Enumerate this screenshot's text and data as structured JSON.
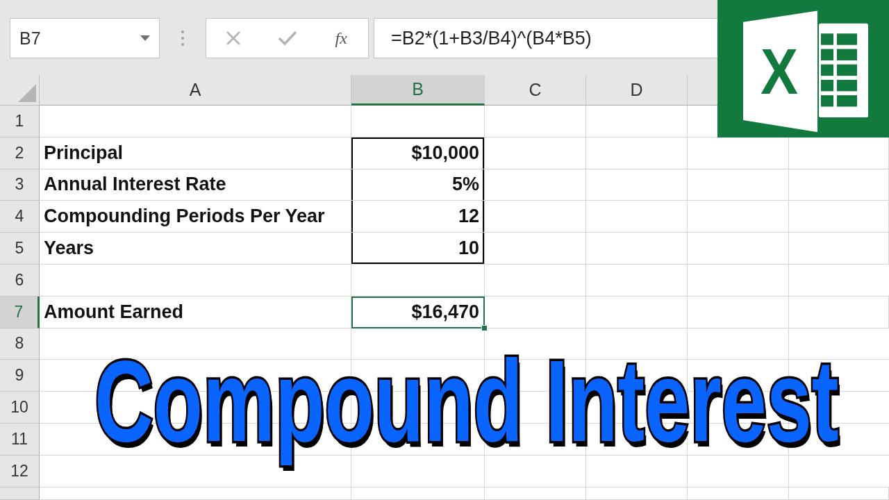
{
  "name_box": {
    "value": "B7"
  },
  "formula_bar": {
    "function_label": "fx",
    "formula": "=B2*(1+B3/B4)^(B4*B5)"
  },
  "columns": [
    {
      "label": "A",
      "selected": false
    },
    {
      "label": "B",
      "selected": true
    },
    {
      "label": "C",
      "selected": false
    },
    {
      "label": "D",
      "selected": false
    }
  ],
  "rows": [
    {
      "number": "1",
      "selected": false,
      "boxed": false
    },
    {
      "number": "2",
      "selected": false,
      "boxed": true,
      "label": "Principal",
      "value": "$10,000"
    },
    {
      "number": "3",
      "selected": false,
      "boxed": true,
      "label": "Annual Interest Rate",
      "value": "5%"
    },
    {
      "number": "4",
      "selected": false,
      "boxed": true,
      "label": "Compounding Periods Per Year",
      "value": "12"
    },
    {
      "number": "5",
      "selected": false,
      "boxed": true,
      "label": "Years",
      "value": "10"
    },
    {
      "number": "6",
      "selected": false,
      "boxed": false
    },
    {
      "number": "7",
      "selected": true,
      "boxed": false,
      "label": "Amount Earned",
      "value": "$16,470"
    },
    {
      "number": "8",
      "selected": false,
      "boxed": false
    },
    {
      "number": "9",
      "selected": false,
      "boxed": false
    },
    {
      "number": "10",
      "selected": false,
      "boxed": false
    },
    {
      "number": "11",
      "selected": false,
      "boxed": false
    },
    {
      "number": "12",
      "selected": false,
      "boxed": false
    }
  ],
  "logo": {
    "letter": "X"
  },
  "title": "Compound Interest"
}
